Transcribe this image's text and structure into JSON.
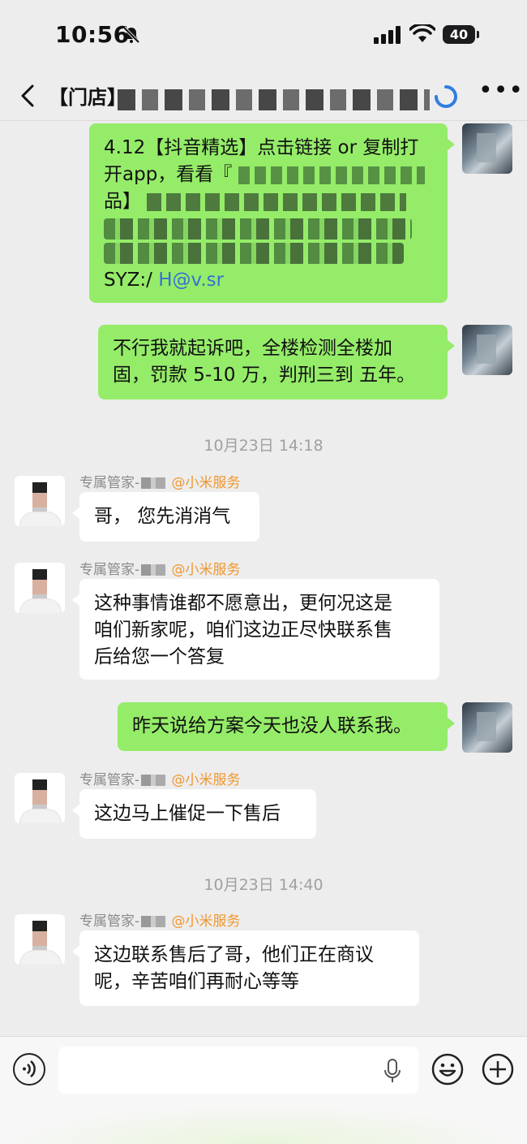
{
  "status_bar": {
    "time": "10:56",
    "battery": "40"
  },
  "header": {
    "title": "【门店】"
  },
  "messages": [
    {
      "side": "self",
      "lines": [
        "4.12【抖音精选】点击链接 or 复制打",
        "开app，看看『",
        "品】"
      ],
      "tail_code": "SYZ:/",
      "tail_link": "H@v.sr"
    },
    {
      "side": "self",
      "lines": [
        "不行我就起诉吧，全楼检测全楼加",
        "固，罚款 5-10 万，判刑三到 五年。"
      ]
    }
  ],
  "timestamps": [
    "10月23日 14:18",
    "10月23日 14:40"
  ],
  "agent_messages": [
    {
      "sender_prefix": "专属管家-",
      "sender_org": "@小米服务",
      "lines": [
        "哥，  您先消消气"
      ]
    },
    {
      "sender_prefix": "专属管家-",
      "sender_org": "@小米服务",
      "lines": [
        "这种事情谁都不愿意出，更何况这是",
        "咱们新家呢，咱们这边正尽快联系售",
        "后给您一个答复"
      ]
    },
    {
      "sender_prefix": "专属管家-",
      "sender_org": "@小米服务",
      "lines": [
        "这边马上催促一下售后"
      ]
    },
    {
      "sender_prefix": "专属管家-",
      "sender_org": "@小米服务",
      "lines": [
        "这边联系售后了哥，他们正在商议",
        "呢，辛苦咱们再耐心等等"
      ]
    }
  ],
  "self_message_3": {
    "lines": [
      "昨天说给方案今天也没人联系我。"
    ]
  },
  "input": {
    "value": ""
  },
  "icons": {
    "back": "chevron-left-icon",
    "more": "more-icon",
    "voice": "voice-icon",
    "mic": "mic-icon",
    "emoji": "emoji-icon",
    "plus": "plus-icon"
  },
  "colors": {
    "self_bubble": "#95ec69",
    "other_bubble": "#ffffff",
    "org_tag": "#f0972e",
    "background": "#ededed"
  }
}
